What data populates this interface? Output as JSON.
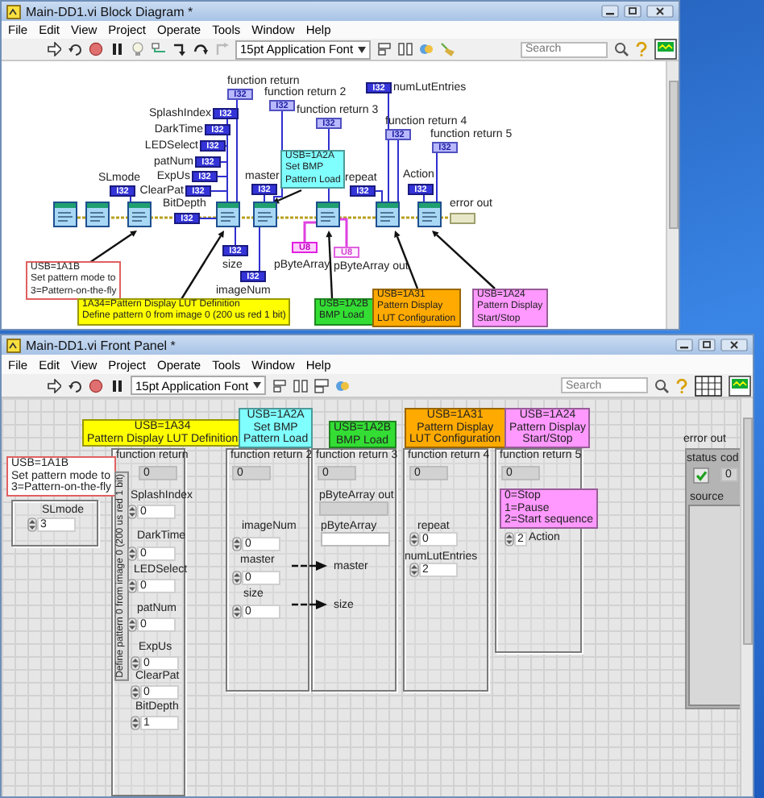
{
  "block_diagram": {
    "title": "Main-DD1.vi Block Diagram *",
    "menu": [
      "File",
      "Edit",
      "View",
      "Project",
      "Operate",
      "Tools",
      "Window",
      "Help"
    ],
    "font": "15pt Application Font",
    "search": {
      "placeholder": "Search"
    },
    "terminals": [
      {
        "label": "function return",
        "kind": "indicator",
        "type": "I32"
      },
      {
        "label": "function return 2",
        "kind": "indicator",
        "type": "I32"
      },
      {
        "label": "numLutEntries",
        "kind": "control",
        "type": "I32"
      },
      {
        "label": "function return 3",
        "kind": "indicator",
        "type": "I32"
      },
      {
        "label": "function return 4",
        "kind": "indicator",
        "type": "I32"
      },
      {
        "label": "function return 5",
        "kind": "indicator",
        "type": "I32"
      },
      {
        "label": "SplashIndex",
        "kind": "control",
        "type": "I32"
      },
      {
        "label": "DarkTime",
        "kind": "control",
        "type": "I32"
      },
      {
        "label": "LEDSelect",
        "kind": "control",
        "type": "I32"
      },
      {
        "label": "patNum",
        "kind": "control",
        "type": "I32"
      },
      {
        "label": "SLmode",
        "kind": "control",
        "type": "I32"
      },
      {
        "label": "ExpUs",
        "kind": "control",
        "type": "I32"
      },
      {
        "label": "ClearPat",
        "kind": "control",
        "type": "I32"
      },
      {
        "label": "master",
        "kind": "control",
        "type": "I32"
      },
      {
        "label": "BitDepth",
        "kind": "control",
        "type": "I32"
      },
      {
        "label": "repeat",
        "kind": "control",
        "type": "I32"
      },
      {
        "label": "Action",
        "kind": "control",
        "type": "I32"
      },
      {
        "label": "error out",
        "kind": "cluster"
      },
      {
        "label": "size",
        "kind": "control",
        "type": "I32"
      },
      {
        "label": "pByteArray",
        "kind": "array",
        "type": "U8"
      },
      {
        "label": "pByteArray out",
        "kind": "array-indicator",
        "type": "U8"
      },
      {
        "label": "imageNum",
        "kind": "control",
        "type": "I32"
      }
    ],
    "comments": [
      {
        "text": "USB=1A2A\nSet BMP\nPattern Load",
        "color": "#80ffff"
      },
      {
        "text": "USB=1A1B\nSet pattern mode to\n3=Pattern-on-the-fly",
        "color": "#ffffff"
      },
      {
        "text": "1A34=Pattern Display LUT Definition\nDefine pattern 0 from image 0 (200 us red 1 bit)",
        "color": "#ffff00"
      },
      {
        "text": "USB=1A2B\nBMP Load",
        "color": "#33dd33"
      },
      {
        "text": "USB=1A31\nPattern Display\nLUT Configuration",
        "color": "#ffaa00"
      },
      {
        "text": "USB=1A24\nPattern Display\nStart/Stop",
        "color": "#ff99ff"
      }
    ]
  },
  "front_panel": {
    "title": "Main-DD1.vi Front Panel *",
    "menu": [
      "File",
      "Edit",
      "View",
      "Project",
      "Operate",
      "Tools",
      "Window",
      "Help"
    ],
    "font": "15pt Application Font",
    "search": {
      "placeholder": "Search"
    },
    "comments": [
      {
        "text": "USB=1A34\nPattern Display LUT Definition",
        "color": "#ffff00"
      },
      {
        "text": "USB=1A2A\nSet BMP\nPattern Load",
        "color": "#80ffff"
      },
      {
        "text": "USB=1A2B\nBMP Load",
        "color": "#33dd33"
      },
      {
        "text": "USB=1A31\nPattern Display\nLUT Configuration",
        "color": "#ffaa00"
      },
      {
        "text": "USB=1A24\nPattern Display\nStart/Stop",
        "color": "#ff99ff"
      },
      {
        "text": "USB=1A1B\nSet pattern mode to\n3=Pattern-on-the-fly",
        "color": "#ffffff"
      },
      {
        "text": "0=Stop\n1=Pause\n2=Start sequence",
        "color": "#ff99ff"
      }
    ],
    "frames": [
      {
        "title": "function return",
        "value": "0"
      },
      {
        "title": "function return 2",
        "value": "0"
      },
      {
        "title": "function return 3",
        "value": "0"
      },
      {
        "title": "function return 4",
        "value": "0"
      },
      {
        "title": "function return 5",
        "value": "0"
      }
    ],
    "frame_caption": "Define pattern 0 from image 0 (200 us red 1 bit)",
    "controls": [
      {
        "label": "SLmode",
        "kind": "numeric",
        "value": "3"
      },
      {
        "label": "SplashIndex",
        "kind": "numeric",
        "value": "0"
      },
      {
        "label": "DarkTime",
        "kind": "numeric",
        "value": "0"
      },
      {
        "label": "LEDSelect",
        "kind": "numeric",
        "value": "0"
      },
      {
        "label": "patNum",
        "kind": "numeric",
        "value": "0"
      },
      {
        "label": "ExpUs",
        "kind": "numeric",
        "value": "0"
      },
      {
        "label": "ClearPat",
        "kind": "numeric",
        "value": "0"
      },
      {
        "label": "BitDepth",
        "kind": "numeric",
        "value": "1"
      },
      {
        "label": "imageNum",
        "kind": "numeric",
        "value": "0"
      },
      {
        "label": "master",
        "kind": "numeric",
        "value": "0"
      },
      {
        "label": "size",
        "kind": "numeric",
        "value": "0"
      },
      {
        "label": "pByteArray out",
        "kind": "array-indicator"
      },
      {
        "label": "pByteArray",
        "kind": "array"
      },
      {
        "label": "repeat",
        "kind": "numeric",
        "value": "0"
      },
      {
        "label": "numLutEntries",
        "kind": "numeric",
        "value": "2"
      },
      {
        "label": "Action",
        "kind": "numeric",
        "value": "2"
      }
    ],
    "arrow_labels": [
      "master",
      "size"
    ],
    "error_out": {
      "label": "error out",
      "status_label": "status",
      "status": false,
      "code_label": "cod",
      "code": "0",
      "source_label": "source"
    }
  }
}
